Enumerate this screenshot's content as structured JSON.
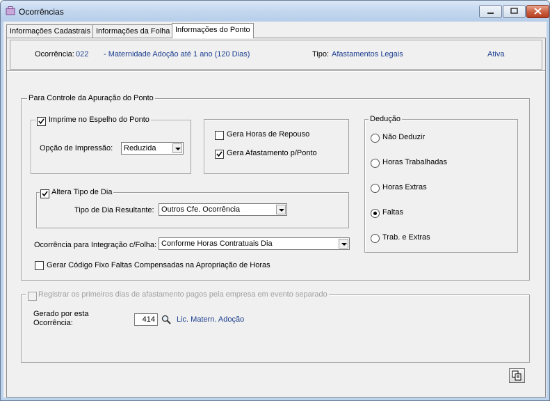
{
  "window": {
    "title": "Ocorrências"
  },
  "tabs": [
    {
      "label": "Informações Cadastrais"
    },
    {
      "label": "Informações da Folha"
    },
    {
      "label": "Informações do Ponto"
    }
  ],
  "header": {
    "ocorrencia_label": "Ocorrência:",
    "ocorrencia_code": "022",
    "ocorrencia_desc": "- Maternidade Adoção até 1 ano (120 Dias)",
    "tipo_label": "Tipo:",
    "tipo_value": "Afastamentos Legais",
    "status": "Ativa"
  },
  "controle": {
    "title": "Para Controle da Apuração do Ponto",
    "imprime_label": "Imprime no Espelho do Ponto",
    "imprime_checked": true,
    "opcao_label": "Opção de Impressão:",
    "opcao_value": "Reduzida",
    "gera_repouso_label": "Gera Horas de Repouso",
    "gera_repouso_checked": false,
    "gera_afast_label": "Gera Afastamento p/Ponto",
    "gera_afast_checked": true,
    "altera_label": "Altera Tipo de Dia",
    "altera_checked": true,
    "tipo_dia_label": "Tipo de Dia Resultante:",
    "tipo_dia_value": "Outros Cfe. Ocorrência",
    "integracao_label": "Ocorrência para Integração c/Folha:",
    "integracao_value": "Conforme Horas Contratuais Dia",
    "gerar_codigo_label": "Gerar Código Fixo Faltas Compensadas na Apropriação de Horas",
    "gerar_codigo_checked": false
  },
  "deducao": {
    "title": "Dedução",
    "options": [
      {
        "label": "Não Deduzir",
        "selected": false
      },
      {
        "label": "Horas Trabalhadas",
        "selected": false
      },
      {
        "label": "Horas Extras",
        "selected": false
      },
      {
        "label": "Faltas",
        "selected": true
      },
      {
        "label": "Trab. e Extras",
        "selected": false
      }
    ]
  },
  "registrar": {
    "label": "Registrar os primeiros dias de afastamento pagos pela empresa em evento separado",
    "checked": false,
    "gerado_label_1": "Gerado por esta",
    "gerado_label_2": "Ocorrência:",
    "code": "414",
    "desc": "Lic. Matern. Adoção"
  },
  "icons": {
    "search": "search-icon",
    "copy": "copy-icon",
    "app": "app-icon"
  }
}
